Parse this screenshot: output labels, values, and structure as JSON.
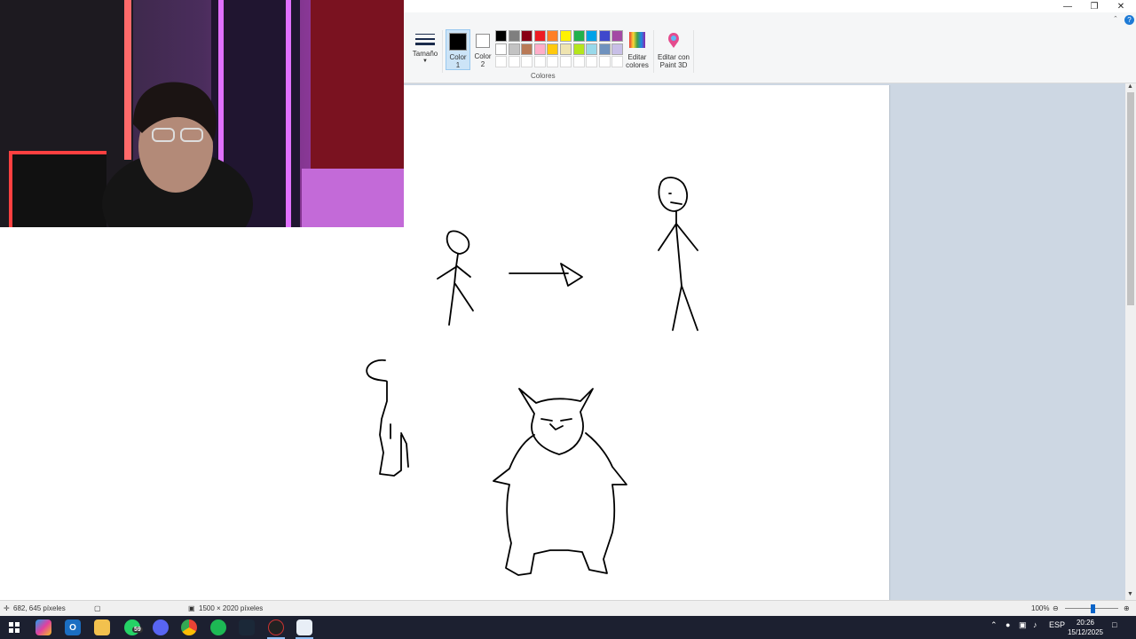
{
  "ribbon": {
    "size_label": "Tamaño",
    "color1_label": "Color\n1",
    "color1_line1": "Color",
    "color1_line2": "1",
    "color2_line1": "Color",
    "color2_line2": "2",
    "edit_colors_line1": "Editar",
    "edit_colors_line2": "colores",
    "paint3d_line1": "Editar con",
    "paint3d_line2": "Paint 3D",
    "group_label": "Colores",
    "color1_value": "#000000",
    "color2_value": "#ffffff",
    "palette_row1": [
      "#000000",
      "#7f7f7f",
      "#880015",
      "#ed1c24",
      "#ff7f27",
      "#fff200",
      "#22b14c",
      "#00a2e8",
      "#3f48cc",
      "#a349a4"
    ],
    "palette_row2": [
      "#ffffff",
      "#c3c3c3",
      "#b97a57",
      "#ffaec9",
      "#ffc90e",
      "#efe4b0",
      "#b5e61d",
      "#99d9ea",
      "#7092be",
      "#c8bfe7"
    ],
    "palette_row3": [
      "#ffffff",
      "#ffffff",
      "#ffffff",
      "#ffffff",
      "#ffffff",
      "#ffffff",
      "#ffffff",
      "#ffffff",
      "#ffffff",
      "#ffffff"
    ]
  },
  "window": {
    "minimize_icon": "minimize-icon",
    "restore_icon": "restore-icon",
    "close_icon": "close-icon"
  },
  "status": {
    "cursor_pos": "682, 645 píxeles",
    "image_size": "1500 × 2020 píxeles",
    "zoom": "100%",
    "zoom_fraction": 0.5
  },
  "taskbar": {
    "whatsapp_badge": "59",
    "language": "ESP",
    "time": "20:26",
    "date": "15/12/2025"
  }
}
